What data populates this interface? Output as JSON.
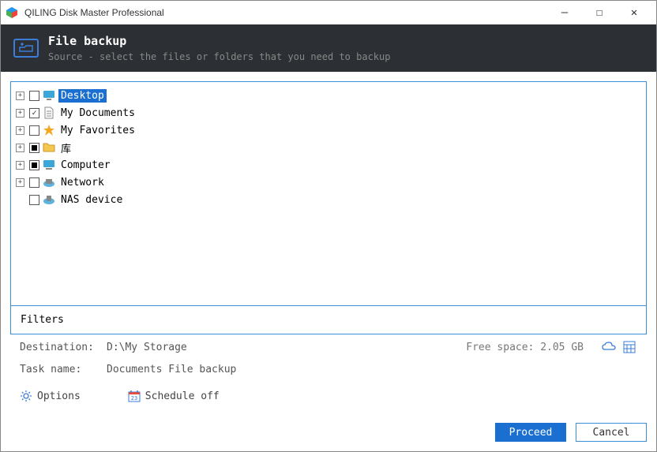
{
  "window": {
    "title": "QILING Disk Master Professional"
  },
  "header": {
    "title": "File backup",
    "subtitle": "Source - select the files or folders that you need to backup"
  },
  "tree": {
    "items": [
      {
        "label": "Desktop",
        "selected": true,
        "checked": "unchecked",
        "expandable": true,
        "icon": "desktop"
      },
      {
        "label": "My Documents",
        "selected": false,
        "checked": "checked",
        "expandable": true,
        "icon": "document"
      },
      {
        "label": "My Favorites",
        "selected": false,
        "checked": "unchecked",
        "expandable": true,
        "icon": "star"
      },
      {
        "label": "库",
        "selected": false,
        "checked": "half",
        "expandable": true,
        "icon": "folder"
      },
      {
        "label": "Computer",
        "selected": false,
        "checked": "half",
        "expandable": true,
        "icon": "computer"
      },
      {
        "label": "Network",
        "selected": false,
        "checked": "unchecked",
        "expandable": true,
        "icon": "network"
      },
      {
        "label": "NAS device",
        "selected": false,
        "checked": "unchecked",
        "expandable": false,
        "icon": "nas"
      }
    ]
  },
  "filters_label": "Filters",
  "destination": {
    "label": "Destination:",
    "value": "D:\\My Storage"
  },
  "free_space": {
    "label": "Free space:",
    "value": "2.05 GB"
  },
  "task_name": {
    "label": "Task name:",
    "value": "Documents File backup"
  },
  "options_label": "Options",
  "schedule_label": "Schedule off",
  "buttons": {
    "proceed": "Proceed",
    "cancel": "Cancel"
  }
}
